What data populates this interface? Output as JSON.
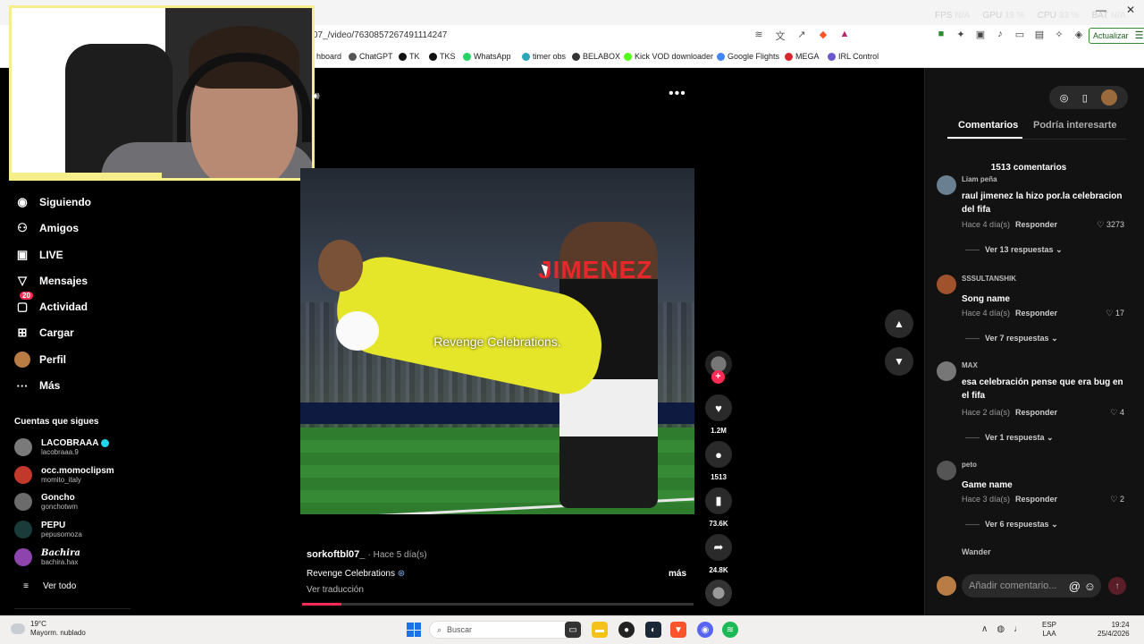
{
  "browser": {
    "url": "07_/video/7630857267491114247",
    "overlay_stats": [
      {
        "label": "FPS",
        "value": "N/A"
      },
      {
        "label": "GPU",
        "value": "19 %"
      },
      {
        "label": "CPU",
        "value": "33 %"
      },
      {
        "label": "BAT",
        "value": "N/A"
      }
    ],
    "update_label": "Actualizar",
    "bookmarks": [
      {
        "label": "hboard",
        "color": "#888888"
      },
      {
        "label": "ChatGPT",
        "color": "#555555"
      },
      {
        "label": "TK",
        "color": "#111111"
      },
      {
        "label": "TKS",
        "color": "#111111"
      },
      {
        "label": "WhatsApp",
        "color": "#25d366"
      },
      {
        "label": "timer obs",
        "color": "#2aa7b8"
      },
      {
        "label": "BELABOX",
        "color": "#333333"
      },
      {
        "label": "Kick VOD downloader",
        "color": "#53fc18"
      },
      {
        "label": "Google Flights",
        "color": "#4285f4"
      },
      {
        "label": "MEGA",
        "color": "#d9272e"
      },
      {
        "label": "IRL Control",
        "color": "#6a5acd"
      }
    ]
  },
  "nav": {
    "items": [
      {
        "label": "Siguiendo",
        "icon": "following-icon"
      },
      {
        "label": "Amigos",
        "icon": "friends-icon"
      },
      {
        "label": "LIVE",
        "icon": "live-icon"
      },
      {
        "label": "Mensajes",
        "icon": "messages-icon"
      },
      {
        "label": "Actividad",
        "icon": "activity-icon",
        "badge": "20"
      },
      {
        "label": "Cargar",
        "icon": "upload-icon"
      },
      {
        "label": "Perfil",
        "icon": "profile-icon"
      },
      {
        "label": "Más",
        "icon": "more-icon"
      }
    ],
    "following_title": "Cuentas que sigues",
    "following": [
      {
        "name": "LACOBRAAA",
        "handle": "lacobraaa.9",
        "verified": true,
        "color": "#7a7a7a"
      },
      {
        "name": "occ.momoclipsm",
        "handle": "momito_italy",
        "verified": false,
        "color": "#c0392b"
      },
      {
        "name": "Goncho",
        "handle": "gonchotwm",
        "verified": false,
        "color": "#6b6b6b"
      },
      {
        "name": "PEPU",
        "handle": "pepusomoza",
        "verified": false,
        "color": "#1a3b3a"
      },
      {
        "name": "Bachira",
        "handle": "bachira.hax",
        "verified": false,
        "color": "#8e44ad"
      }
    ],
    "see_all": "Ver todo"
  },
  "video": {
    "overlay_name": "JIMENEZ",
    "overlay_caption": "Revenge Celebrations.",
    "author": "sorkoftbl07_",
    "posted": "· Hace 5 día(s)",
    "caption": "Revenge Celebrations",
    "more": "más",
    "translate": "Ver traducción",
    "progress_percent": 10,
    "likes": "1.2M",
    "comments": "1513",
    "saves": "73.6K",
    "shares": "24.8K"
  },
  "comments_panel": {
    "tab_comments": "Comentarios",
    "tab_interest": "Podría interesarte",
    "count_label": "1513 comentarios",
    "comments": [
      {
        "user": "Liam peña",
        "text": "raul jimenez la hizo por.la celebracion del fifa",
        "time": "Hace 4 día(s)",
        "reply": "Responder",
        "likes": "3273",
        "view_replies": "Ver 13 respuestas",
        "color": "#6a7f8f"
      },
      {
        "user": "SSSULTANSHIK",
        "text": "Song name",
        "time": "Hace 4 día(s)",
        "reply": "Responder",
        "likes": "17",
        "view_replies": "Ver 7 respuestas",
        "color": "#a0522d"
      },
      {
        "user": "MAX",
        "text": "esa celebración pense que era bug en el fifa",
        "time": "Hace 2 día(s)",
        "reply": "Responder",
        "likes": "4",
        "view_replies": "Ver 1 respuesta",
        "color": "#777777"
      },
      {
        "user": "peto",
        "text": "Game name",
        "time": "Hace 3 día(s)",
        "reply": "Responder",
        "likes": "2",
        "view_replies": "Ver 6 respuestas",
        "color": "#555555"
      }
    ],
    "next_user": "Wander",
    "input_placeholder": "Añadir comentario..."
  },
  "taskbar": {
    "temperature": "19°C",
    "weather": "Mayorm. nublado",
    "search": "Buscar",
    "lang1": "ESP",
    "lang2": "LAA",
    "time": "19:24",
    "date": "25/4/2026"
  }
}
